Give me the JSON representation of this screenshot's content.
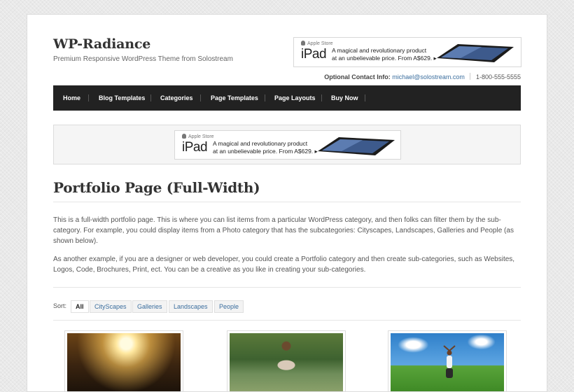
{
  "site": {
    "title": "WP-Radiance",
    "description": "Premium Responsive WordPress Theme from Solostream"
  },
  "ad": {
    "apple_store": "Apple Store",
    "product": "iPad",
    "line1": "A magical and revolutionary product",
    "line2": "at an unbelievable price. From A$629. ▸"
  },
  "contact": {
    "label": "Optional Contact Info:",
    "email": "michael@solostream.com",
    "phone": "1-800-555-5555"
  },
  "nav": {
    "items": [
      "Home",
      "Blog Templates",
      "Categories",
      "Page Templates",
      "Page Layouts",
      "Buy Now"
    ]
  },
  "page": {
    "title": "Portfolio Page (Full-Width)",
    "paragraph1": "This is a full-width portfolio page. This is where you can list items from a particular WordPress category, and then folks can filter them by the sub-category. For example, you could display items from a Photo category that has the subcategories: Cityscapes, Landscapes, Galleries and People (as shown below).",
    "paragraph2": "As another example, if you are a designer or web developer, you could create a Portfolio category and then create sub-categories, such as Websites, Logos, Code, Brochures, Print, ect. You can be a creative as you like in creating your sub-categories."
  },
  "sort": {
    "label": "Sort:",
    "filters": [
      "All",
      "CityScapes",
      "Galleries",
      "Landscapes",
      "People"
    ],
    "active": "All"
  },
  "colors": {
    "nav_bg": "#222222",
    "link": "#3b6e9e",
    "heading": "#333333"
  }
}
